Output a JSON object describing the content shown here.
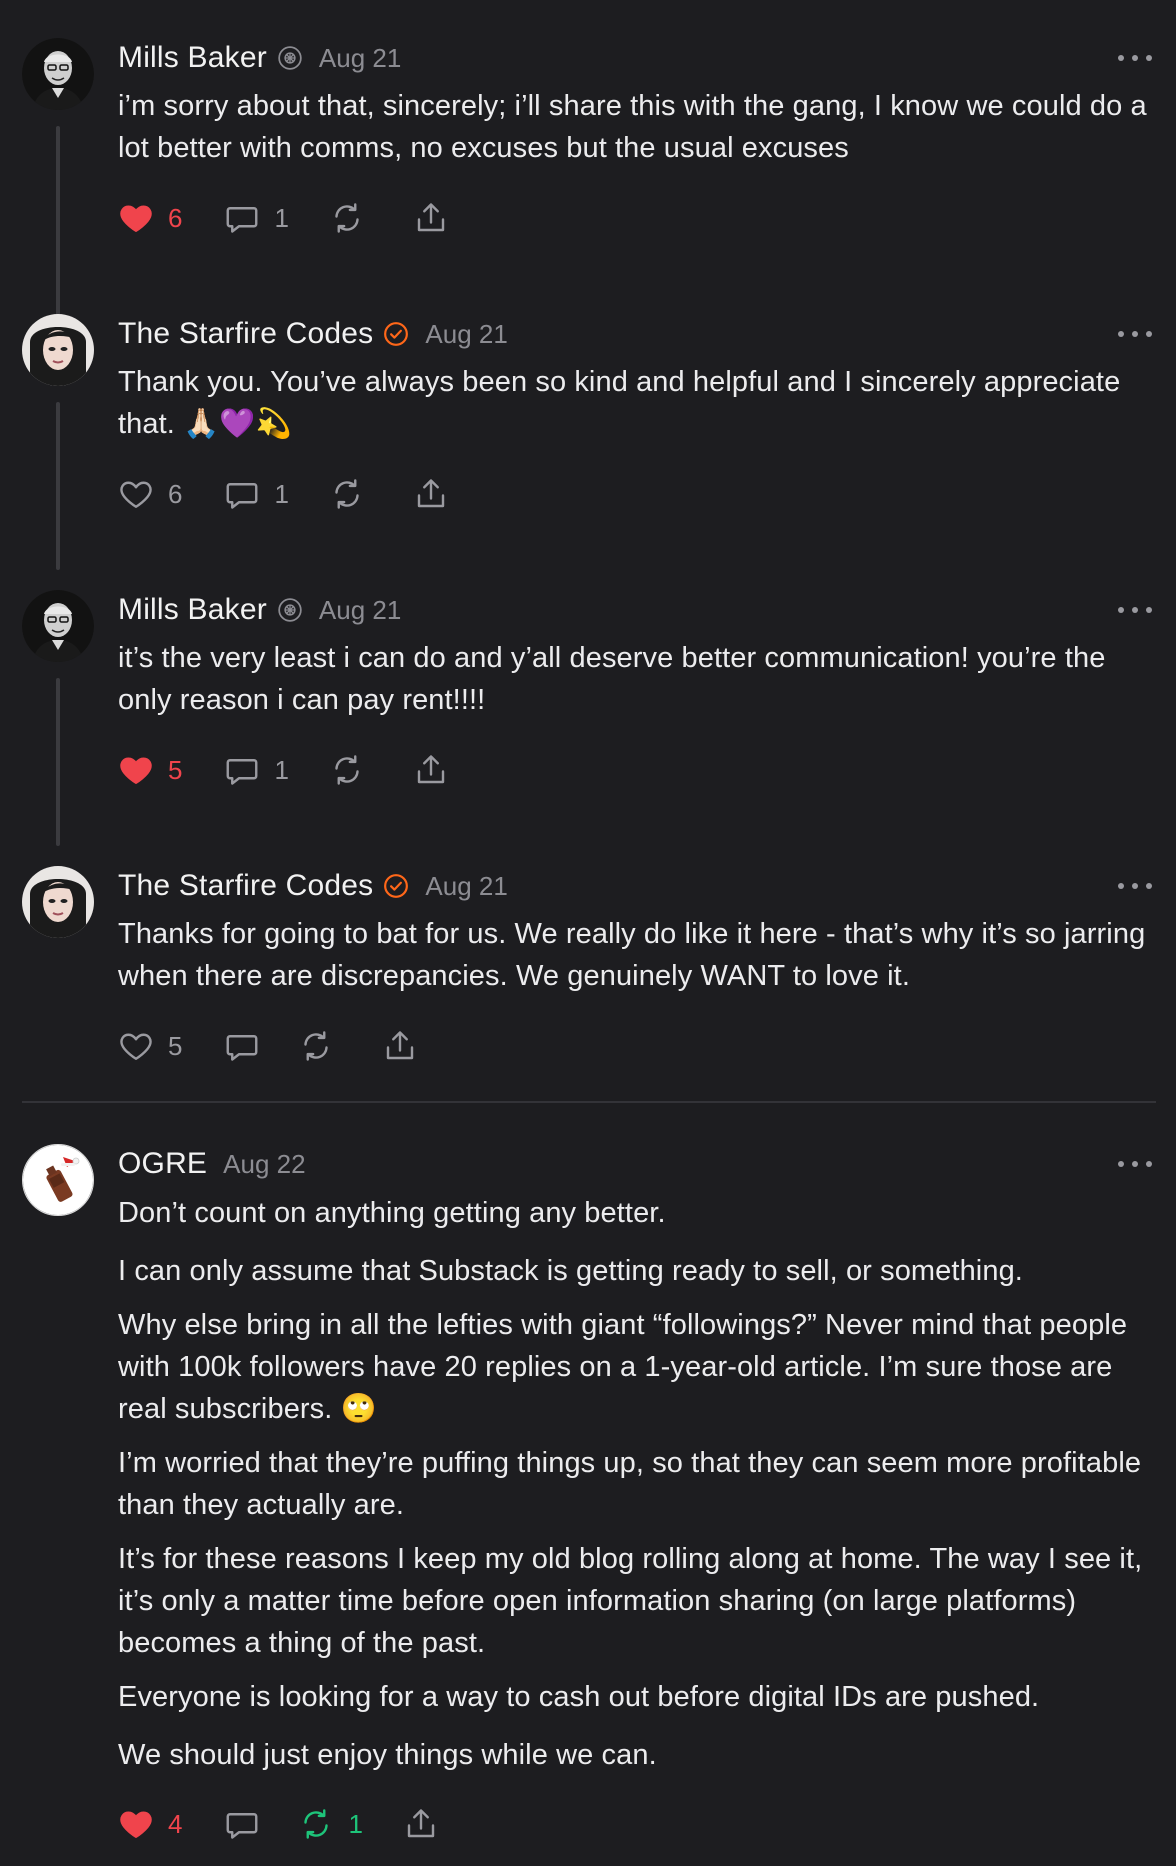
{
  "comments": [
    {
      "author": "Mills Baker",
      "date": "Aug 21",
      "paragraphs": [
        "i’m sorry about that, sincerely; i’ll share this with the gang, I know we could do a lot better with comms, no excuses but the usual excuses"
      ],
      "likes": "6",
      "replies": "1",
      "restacks": "",
      "liked": true
    },
    {
      "author": "The Starfire Codes",
      "date": "Aug 21",
      "paragraphs": [
        "Thank you. You’ve always been so kind and helpful and I sincerely appreciate that. 🙏🏻💜💫"
      ],
      "likes": "6",
      "replies": "1",
      "restacks": "",
      "liked": false
    },
    {
      "author": "Mills Baker",
      "date": "Aug 21",
      "paragraphs": [
        "it’s the very least i can do and y’all deserve better communication! you’re the only reason i can pay rent!!!!"
      ],
      "likes": "5",
      "replies": "1",
      "restacks": "",
      "liked": true
    },
    {
      "author": "The Starfire Codes",
      "date": "Aug 21",
      "paragraphs": [
        "Thanks for going to bat for us. We really do like it here - that’s why it’s so jarring when there are discrepancies. We genuinely WANT to love it."
      ],
      "likes": "5",
      "replies": "",
      "restacks": "",
      "liked": false
    },
    {
      "author": "OGRE",
      "date": "Aug 22",
      "paragraphs": [
        "Don’t count on anything getting any better.",
        "I can only assume that Substack is getting ready to sell, or something.",
        "Why else bring in all the lefties with giant “followings?” Never mind that people with 100k followers have 20 replies on a 1-year-old article. I’m sure those are real subscribers. 🙄",
        "I’m worried that they’re puffing things up, so that they can seem more profitable than they actually are.",
        "It’s for these reasons I keep my old blog rolling along at home. The way I see it, it’s only a matter time before open information sharing (on large platforms) becomes a thing of the past.",
        "Everyone is looking for a way to cash out before digital IDs are pushed.",
        "We should just enjoy things while we can."
      ],
      "likes": "4",
      "replies": "",
      "restacks": "1",
      "liked": true
    }
  ],
  "colors": {
    "background": "#1d1d20",
    "like_active": "#f0444c",
    "restack_active": "#1ec47a",
    "verified_badge": "#ff6719",
    "muted": "#8c8c92"
  },
  "icons": [
    "heart-icon",
    "comment-icon",
    "restack-icon",
    "share-icon",
    "more-icon",
    "verified-badge-icon",
    "founder-badge-icon"
  ]
}
